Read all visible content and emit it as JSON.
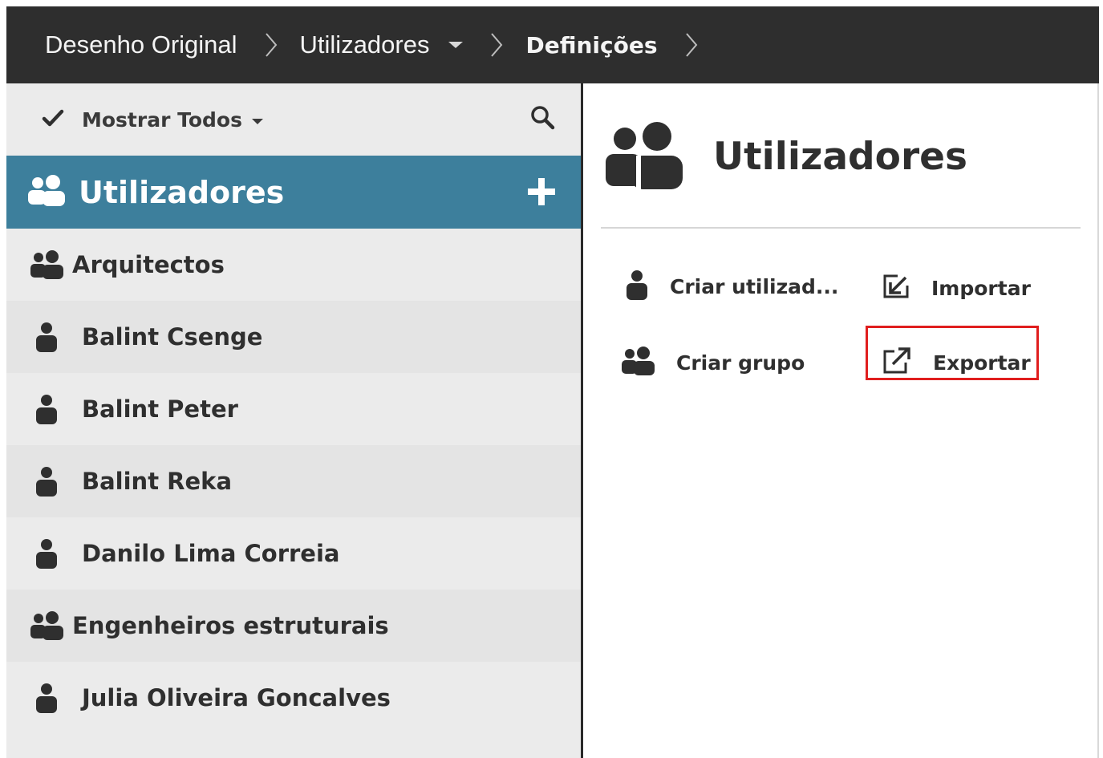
{
  "breadcrumb": {
    "items": [
      {
        "label": "Desenho Original"
      },
      {
        "label": "Utilizadores"
      },
      {
        "label": "Definições"
      }
    ]
  },
  "sidebar": {
    "filter_label": "Mostrar Todos",
    "group_title": "Utilizadores",
    "items": [
      {
        "label": "Arquitectos",
        "type": "group"
      },
      {
        "label": "Balint Csenge",
        "type": "user"
      },
      {
        "label": "Balint Peter",
        "type": "user"
      },
      {
        "label": "Balint Reka",
        "type": "user"
      },
      {
        "label": "Danilo Lima Correia",
        "type": "user"
      },
      {
        "label": "Engenheiros estruturais",
        "type": "group"
      },
      {
        "label": "Julia Oliveira Goncalves",
        "type": "user"
      }
    ]
  },
  "main": {
    "title": "Utilizadores",
    "actions": {
      "create_user": "Criar utilizad...",
      "import": "Importar",
      "create_group": "Criar grupo",
      "export": "Exportar"
    }
  },
  "icons": {
    "check": "check-icon",
    "search": "search-icon",
    "add": "plus-icon",
    "user": "user-icon",
    "group": "users-group-icon",
    "import": "import-icon",
    "export": "export-icon"
  },
  "colors": {
    "topbar": "#2e2e2e",
    "accent": "#3d7f9c",
    "highlight": "#e01e1e"
  }
}
